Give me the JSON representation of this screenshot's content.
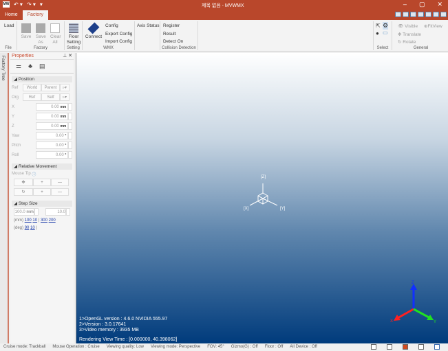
{
  "window": {
    "title": "제목 없음 - MVWMX",
    "app_logo": "MW"
  },
  "tabs": [
    {
      "label": "Home"
    },
    {
      "label": "Factory",
      "active": true
    }
  ],
  "ribbon": {
    "file": {
      "label": "File",
      "load": "Load"
    },
    "factory": {
      "label": "Factory",
      "save": "Save",
      "save_as": "Save As",
      "clear_all": "Clear All"
    },
    "setting": {
      "label": "Setting",
      "floor_setting": "Floor Setting"
    },
    "wmx": {
      "label": "WMX",
      "connect": "Connect",
      "config": "Config",
      "export_config": "Export Config",
      "import_config": "Import Config"
    },
    "axis_status": "Axis Status",
    "collision": {
      "label": "Collision Detection",
      "register": "Register",
      "result": "Result",
      "detect_on": "Detect On"
    },
    "select": {
      "label": "Select"
    },
    "general": {
      "label": "General",
      "visible": "Visible",
      "fitview": "FitView",
      "translate": "Translate",
      "rotate": "Rotate"
    }
  },
  "factory_tree": "Factory Tree",
  "properties": {
    "title": "Properties",
    "position": {
      "header": "Position",
      "ref_label": "Ref",
      "ref_opts": [
        "World",
        "Parent"
      ],
      "org_label": "Org",
      "org_opts": [
        "Ref",
        "Self"
      ],
      "fields": [
        {
          "label": "X",
          "value": "0.00",
          "unit": "mm"
        },
        {
          "label": "Y",
          "value": "0.00",
          "unit": "mm"
        },
        {
          "label": "Z",
          "value": "0.00",
          "unit": "mm"
        },
        {
          "label": "Yaw",
          "value": "0.00",
          "unit": "°"
        },
        {
          "label": "Pitch",
          "value": "0.00",
          "unit": "°"
        },
        {
          "label": "Roll",
          "value": "0.00",
          "unit": "°"
        }
      ]
    },
    "relative": {
      "header": "Relative Movement",
      "mouse_tip": "Mouse Tip"
    },
    "step": {
      "header": "Step Size",
      "mm_value": "100.0",
      "mm_unit": "mm",
      "deg_value": "10.0",
      "mm_label": "(mm)",
      "mm_links": [
        "100",
        "10",
        "300",
        "200"
      ],
      "deg_label": "(deg)",
      "deg_links": [
        "90",
        "10"
      ]
    }
  },
  "viewport": {
    "axis_labels": {
      "z": "[Z]",
      "x": "[X]",
      "y": "[Y]"
    },
    "info": [
      "1>OpenGL version : 4.6.0 NVIDIA 555.97",
      "2>Version : 3.0.17641",
      "3>Video memory : 3935 MB"
    ],
    "render_time": "Rendering View Time : [0.000000, 40.398062]",
    "gizmo": {
      "x": "X",
      "y": "Y",
      "z": "Z",
      "x_color": "#ff2020",
      "y_color": "#20e020",
      "z_color": "#1030ff"
    }
  },
  "status": [
    "Cruise mode: Trackball",
    "Mouse Operation : Cruise",
    "Viewing quality: Low",
    "Viewing mode: Perspective",
    "FOV: 45°",
    "Gizmo(G) : Off",
    "Floor : Off",
    "All Device : Off"
  ],
  "colors": {
    "accent": "#b9472b"
  }
}
